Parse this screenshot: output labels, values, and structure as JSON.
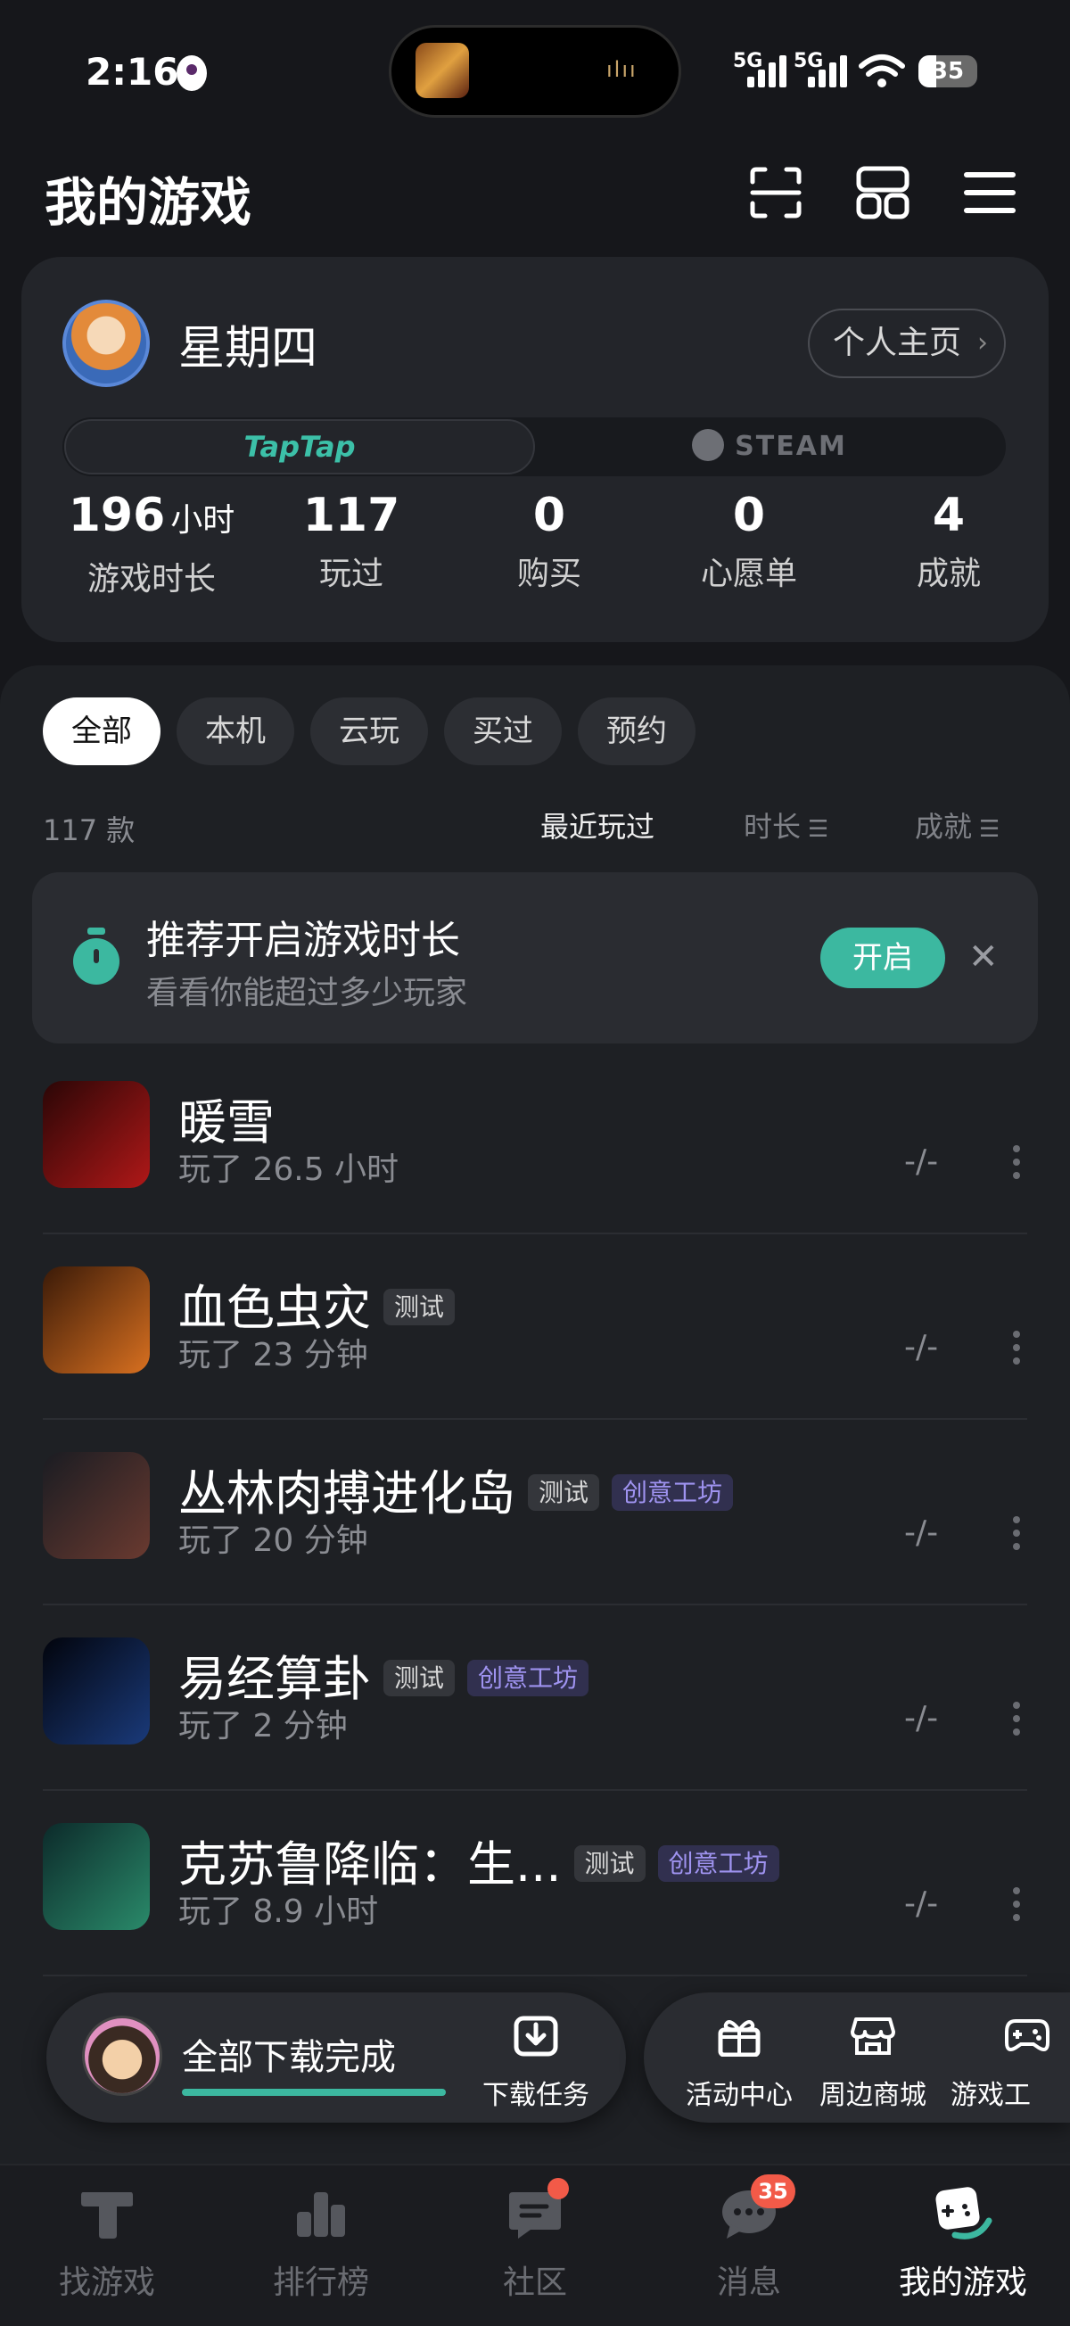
{
  "status_bar": {
    "time": "2:16",
    "network_1": "5G",
    "network_2": "5G",
    "battery": "35"
  },
  "header": {
    "title": "我的游戏",
    "icons": [
      "scan-icon",
      "grid-icon",
      "menu-icon"
    ]
  },
  "profile": {
    "name": "星期四",
    "homepage_label": "个人主页",
    "platforms": {
      "taptap": "TapTap",
      "steam": "STEAM",
      "selected": "taptap"
    },
    "stats": [
      {
        "value": "196",
        "unit": "小时",
        "label": "游戏时长"
      },
      {
        "value": "117",
        "unit": "",
        "label": "玩过"
      },
      {
        "value": "0",
        "unit": "",
        "label": "购买"
      },
      {
        "value": "0",
        "unit": "",
        "label": "心愿单"
      },
      {
        "value": "4",
        "unit": "",
        "label": "成就"
      }
    ]
  },
  "filters": {
    "chips": [
      "全部",
      "本机",
      "云玩",
      "买过",
      "预约"
    ],
    "selected": "全部"
  },
  "list": {
    "count": "117 款",
    "sorts": [
      "最近玩过",
      "时长",
      "成就"
    ],
    "active_sort": "最近玩过"
  },
  "recommend": {
    "title": "推荐开启游戏时长",
    "subtitle": "看看你能超过多少玩家",
    "button": "开启"
  },
  "games": [
    {
      "name": "暖雪",
      "tags": [],
      "played": "玩了 26.5 小时",
      "achievement": "-/-",
      "icon_colors": [
        "#2a0606",
        "#b01818"
      ]
    },
    {
      "name": "血色虫灾",
      "tags": [
        "测试"
      ],
      "played": "玩了 23 分钟",
      "achievement": "-/-",
      "icon_colors": [
        "#3a1a08",
        "#d87020"
      ]
    },
    {
      "name": "丛林肉搏进化岛",
      "tags": [
        "测试",
        "创意工坊"
      ],
      "played": "玩了 20 分钟",
      "achievement": "-/-",
      "icon_colors": [
        "#1a1c22",
        "#6a3a30"
      ]
    },
    {
      "name": "易经算卦",
      "tags": [
        "测试",
        "创意工坊"
      ],
      "played": "玩了 2 分钟",
      "achievement": "-/-",
      "icon_colors": [
        "#02040c",
        "#1a3a7a"
      ]
    },
    {
      "name": "克苏鲁降临：生...",
      "tags": [
        "测试",
        "创意工坊"
      ],
      "played": "玩了 8.9 小时",
      "achievement": "-/-",
      "icon_colors": [
        "#0c2a2a",
        "#2a8a6a"
      ]
    }
  ],
  "download_bar": {
    "text": "全部下载完成",
    "task_label": "下载任务",
    "progress": 1.0
  },
  "quick_actions": [
    "活动中心",
    "周边商城",
    "游戏工"
  ],
  "bottom_nav": {
    "items": [
      "找游戏",
      "排行榜",
      "社区",
      "消息",
      "我的游戏"
    ],
    "active": "我的游戏",
    "message_badge": "35"
  },
  "colors": {
    "accent": "#3cb8a0",
    "background": "#16171b",
    "badge": "#f25a48",
    "tag_craft": "#9f93f0"
  }
}
